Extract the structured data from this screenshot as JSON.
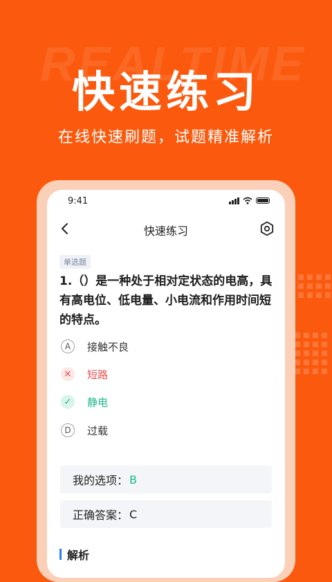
{
  "hero": {
    "background_word": "REALTIME",
    "title": "快速练习",
    "subtitle": "在线快速刷题，试题精准解析"
  },
  "status_bar": {
    "time": "9:41"
  },
  "nav": {
    "title": "快速练习",
    "back_icon": "chevron-left-icon",
    "settings_icon": "hexagon-settings-icon"
  },
  "question": {
    "tag": "单选题",
    "text": "1.（）是一种处于相对定状态的电高，具有高电位、低电量、小电流和作用时间短的特点。",
    "options": [
      {
        "mark": "A",
        "label": "接触不良",
        "state": "normal"
      },
      {
        "mark": "✕",
        "label": "短路",
        "state": "wrong"
      },
      {
        "mark": "✓",
        "label": "静电",
        "state": "correct"
      },
      {
        "mark": "D",
        "label": "过载",
        "state": "normal"
      }
    ]
  },
  "answers": {
    "mine_label": "我的选项：",
    "mine_value": "B",
    "correct_label": "正确答案：",
    "correct_value": "C"
  },
  "analysis": {
    "label": "解析"
  },
  "colors": {
    "brand": "#fb5a0e",
    "wrong": "#ee4d4d",
    "correct": "#1cb98a",
    "accent": "#2b7cf6"
  }
}
